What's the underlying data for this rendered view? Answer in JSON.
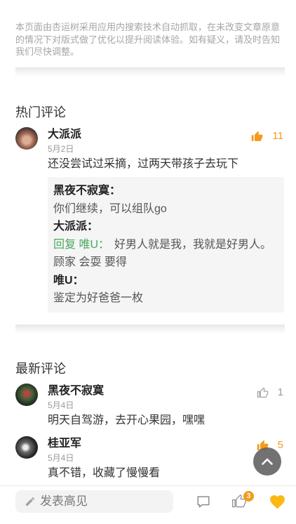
{
  "disclaimer": "本页面由杏运树采用应用内搜索技术自动抓取，在未改变文章原意的情况下对版式做了优化以提升阅读体验。如有疑义，请及时告知我们尽快调整。",
  "hot_comments": {
    "heading": "热门评论",
    "items": [
      {
        "name": "大派派",
        "date": "5月2日",
        "likes": 11,
        "liked": true,
        "text": "还没尝试过采摘，过两天带孩子去玩下",
        "replies": [
          {
            "author": "黑夜不寂寞：",
            "text": "你们继续，可以组队go"
          },
          {
            "author": "大派派：",
            "reply_to": "回复 唯U：",
            "text": "好男人就是我，我就是好男人。顾家 会耍 要得"
          },
          {
            "author": "唯U：",
            "text": "鉴定为好爸爸一枚"
          }
        ]
      }
    ]
  },
  "latest_comments": {
    "heading": "最新评论",
    "items": [
      {
        "name": "黑夜不寂寞",
        "date": "5月4日",
        "likes": 1,
        "liked": false,
        "text": "明天自驾游，去开心果园，嘿嘿"
      },
      {
        "name": "桂亚军",
        "date": "5月4日",
        "likes": 5,
        "liked": true,
        "text": "真不错，收藏了慢慢看"
      }
    ]
  },
  "bottom_bar": {
    "compose_placeholder": "发表高见",
    "like_badge": 3,
    "favorited": true
  },
  "icons": {
    "like": "thumbs-up-icon",
    "compose": "pencil-icon",
    "comments": "comment-icon",
    "favorite": "heart-icon",
    "scroll_top": "chevron-up-icon"
  },
  "colors": {
    "accent": "#f39b1d",
    "favorite": "#fbb815",
    "reply_link": "#4aa95c",
    "icon_gray": "#9a9a9a"
  }
}
